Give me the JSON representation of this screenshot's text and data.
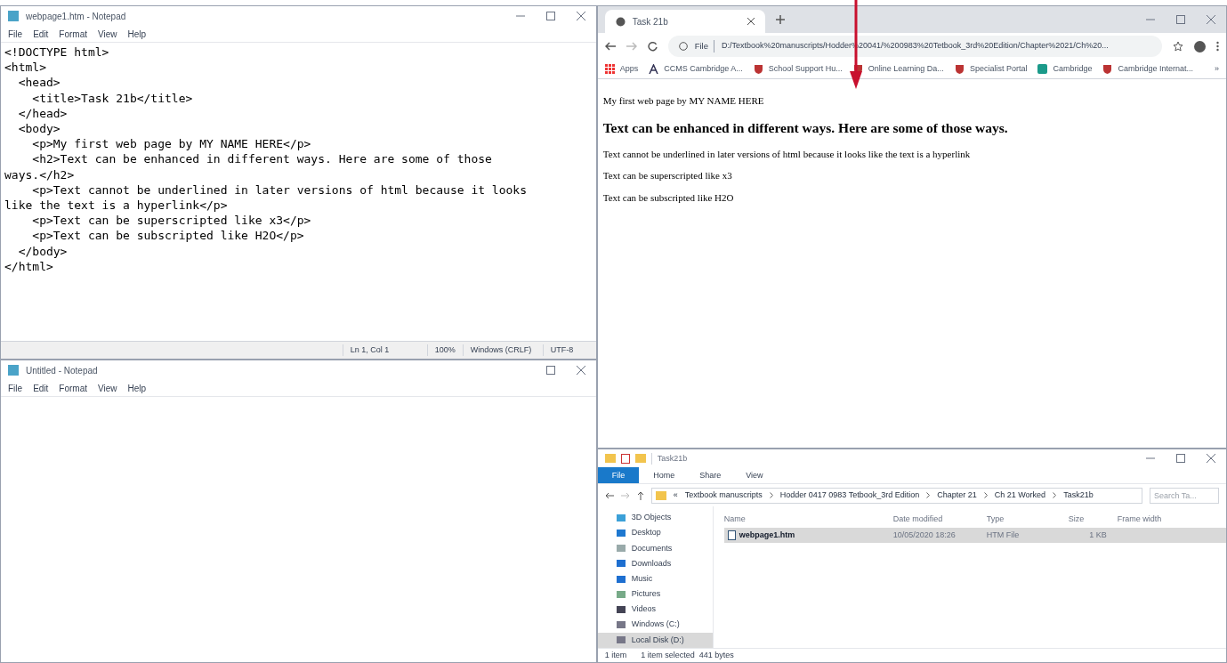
{
  "notepad_main": {
    "title": "webpage1.htm - Notepad",
    "menu": [
      "File",
      "Edit",
      "Format",
      "View",
      "Help"
    ],
    "lines": [
      "<!DOCTYPE html>",
      "<html>",
      "  <head>",
      "    <title>Task 21b</title>",
      "  </head>",
      "  <body>",
      "    <p>My first web page by MY NAME HERE</p>",
      "    <h2>Text can be enhanced in different ways. Here are some of those",
      "ways.</h2>",
      "    <p>Text cannot be underlined in later versions of html because it looks",
      "like the text is a hyperlink</p>",
      "    <p>Text can be superscripted like x3</p>",
      "    <p>Text can be subscripted like H2O</p>",
      "  </body>",
      "</html>"
    ],
    "status": [
      "Ln 1, Col 1",
      "100%",
      "Windows (CRLF)",
      "UTF-8"
    ]
  },
  "notepad_blank": {
    "title": "Untitled - Notepad",
    "menu": [
      "File",
      "Edit",
      "Format",
      "View",
      "Help"
    ]
  },
  "browser": {
    "tab_title": "Task 21b",
    "scheme": "File",
    "url": "D:/Textbook%20manuscripts/Hodder%20041/%200983%20Tetbook_3rd%20Edition/Chapter%2021/Ch%20...",
    "bookmarks": [
      {
        "kind": "apps",
        "label": "Apps"
      },
      {
        "kind": "letter",
        "label": "CCMS Cambridge A..."
      },
      {
        "kind": "crest",
        "label": "School Support Hu..."
      },
      {
        "kind": "crest",
        "label": "Online Learning Da..."
      },
      {
        "kind": "crest",
        "label": "Specialist Portal"
      },
      {
        "kind": "teal",
        "label": "Cambridge"
      },
      {
        "kind": "crest",
        "label": "Cambridge Internat..."
      }
    ],
    "more": "»",
    "page": [
      {
        "kind": "p",
        "text": "My first web page by MY NAME HERE"
      },
      {
        "kind": "h2",
        "text": "Text can be enhanced in different ways. Here are some of those ways."
      },
      {
        "kind": "p",
        "text": "Text cannot be underlined in later versions of html because it looks like the text is a hyperlink"
      },
      {
        "kind": "p",
        "text": "Text can be superscripted like x3"
      },
      {
        "kind": "p",
        "text": "Text can be subscripted like H2O"
      }
    ]
  },
  "explorer": {
    "title": "Task21b",
    "ribbon": [
      {
        "label": "File",
        "selected": true
      },
      {
        "label": "Home",
        "selected": false
      },
      {
        "label": "Share",
        "selected": false
      },
      {
        "label": "View",
        "selected": false
      }
    ],
    "path": [
      "«",
      "Textbook manuscripts",
      "Hodder 0417 0983 Tetbook_3rd Edition",
      "Chapter 21",
      "Ch 21 Worked",
      "Task21b"
    ],
    "search_placeholder": "Search Ta...",
    "tree": [
      {
        "label": "3D Objects",
        "selected": false
      },
      {
        "label": "Desktop",
        "selected": false
      },
      {
        "label": "Documents",
        "selected": false
      },
      {
        "label": "Downloads",
        "selected": false
      },
      {
        "label": "Music",
        "selected": false
      },
      {
        "label": "Pictures",
        "selected": false
      },
      {
        "label": "Videos",
        "selected": false
      },
      {
        "label": "Windows (C:)",
        "selected": false
      },
      {
        "label": "Local Disk (D:)",
        "selected": true
      }
    ],
    "columns": [
      "Name",
      "Date modified",
      "Type",
      "Size",
      "Frame width"
    ],
    "files": [
      {
        "name": "webpage1.htm",
        "date": "10/05/2020 18:26",
        "type": "HTM File",
        "size": "1 KB",
        "selected": true
      }
    ],
    "status": [
      "1 item",
      "1 item selected  441 bytes"
    ]
  }
}
